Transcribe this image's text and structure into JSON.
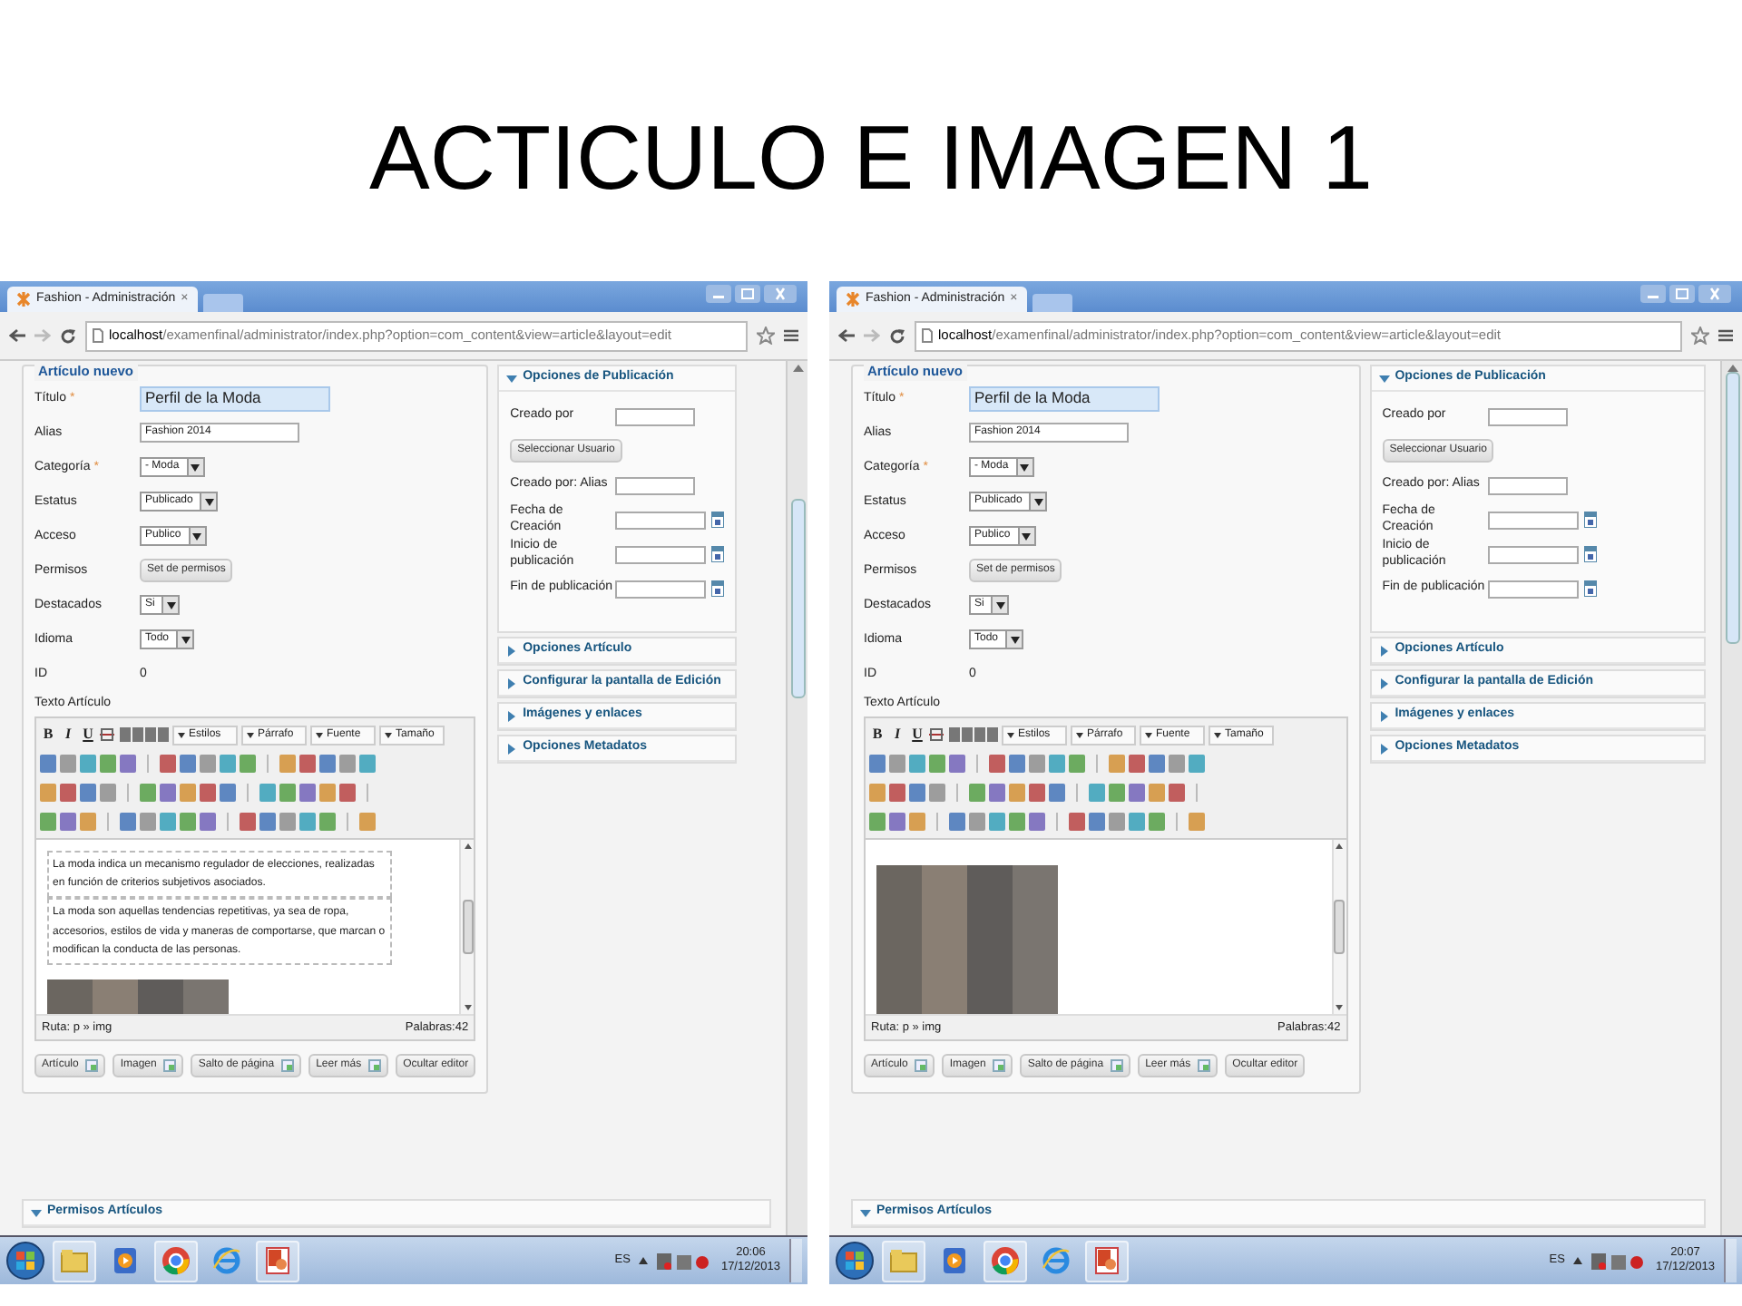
{
  "slide_title": "ACTICULO E IMAGEN 1",
  "screenshots": [
    {
      "browser": {
        "tab_title": "Fashion - Administración",
        "tab_close": "×",
        "url_host": "localhost",
        "url_path": "/examenfinal/administrator/index.php?option=com_content&view=article&layout=edit"
      },
      "article": {
        "legend": "Artículo nuevo",
        "fields": [
          {
            "kind": "text",
            "label": "Título",
            "required_mark": "*",
            "value": "Perfil de la Moda",
            "highlighted": true
          },
          {
            "kind": "text",
            "label": "Alias",
            "value": "Fashion 2014",
            "highlighted": false
          },
          {
            "kind": "select",
            "label": "Categoría",
            "required_mark": "*",
            "value": "- Moda"
          },
          {
            "kind": "select",
            "label": "Estatus",
            "value": "Publicado"
          },
          {
            "kind": "select",
            "label": "Acceso",
            "value": "Publico"
          },
          {
            "kind": "button",
            "label": "Permisos",
            "value": "Set de permisos"
          },
          {
            "kind": "select",
            "label": "Destacados",
            "value": "Si"
          },
          {
            "kind": "select",
            "label": "Idioma",
            "value": "Todo"
          },
          {
            "kind": "static",
            "label": "ID",
            "value": "0"
          }
        ],
        "editor_label": "Texto Artículo"
      },
      "editor": {
        "format_buttons": [
          "B",
          "I",
          "U"
        ],
        "dropdowns": [
          "Estilos",
          "Párrafo",
          "Fuente",
          "Tamaño"
        ],
        "content": [
          {
            "kind": "paragraph",
            "text": "La moda indica un mecanismo regulador de elecciones, realizadas en función de criterios subjetivos asociados."
          },
          {
            "kind": "paragraph",
            "text": "La moda son aquellas tendencias repetitivas, ya sea de ropa, accesorios, estilos de vida y maneras de comportarse, que marcan o modifican la conducta de las personas."
          },
          {
            "kind": "image"
          }
        ],
        "path": "Ruta: p » img",
        "word_count": "Palabras:42"
      },
      "editor_buttons": [
        {
          "label": "Artículo",
          "has_icon": true
        },
        {
          "label": "Imagen",
          "has_icon": true
        },
        {
          "label": "Salto de página",
          "has_icon": true
        },
        {
          "label": "Leer más",
          "has_icon": true
        },
        {
          "label": "Ocultar editor",
          "has_icon": false
        }
      ],
      "sidebar": {
        "sections": [
          {
            "title": "Opciones de Publicación",
            "expanded": true,
            "fields": [
              {
                "kind": "input",
                "label": "Creado por"
              },
              {
                "kind": "button",
                "label": "Seleccionar Usuario"
              },
              {
                "kind": "input",
                "label": "Creado por: Alias"
              },
              {
                "kind": "date",
                "label": "Fecha de Creación"
              },
              {
                "kind": "date",
                "label": "Inicio de publicación"
              },
              {
                "kind": "date",
                "label": "Fin de publicación"
              }
            ]
          },
          {
            "title": "Opciones Artículo",
            "expanded": false
          },
          {
            "title": "Configurar la pantalla de Edición",
            "expanded": false
          },
          {
            "title": "Imágenes y enlaces",
            "expanded": false
          },
          {
            "title": "Opciones Metadatos",
            "expanded": false
          }
        ]
      },
      "permissions_section": {
        "title": "Permisos Artículos",
        "expanded": true
      },
      "taskbar": {
        "language": "ES",
        "time": "20:06",
        "date": "17/12/2013"
      }
    },
    {
      "browser": {
        "tab_title": "Fashion - Administración",
        "tab_close": "×",
        "url_host": "localhost",
        "url_path": "/examenfinal/administrator/index.php?option=com_content&view=article&layout=edit"
      },
      "article": {
        "legend": "Artículo nuevo",
        "fields": [
          {
            "kind": "text",
            "label": "Título",
            "required_mark": "*",
            "value": "Perfil de la Moda",
            "highlighted": true
          },
          {
            "kind": "text",
            "label": "Alias",
            "value": "Fashion 2014",
            "highlighted": false
          },
          {
            "kind": "select",
            "label": "Categoría",
            "required_mark": "*",
            "value": "- Moda"
          },
          {
            "kind": "select",
            "label": "Estatus",
            "value": "Publicado"
          },
          {
            "kind": "select",
            "label": "Acceso",
            "value": "Publico"
          },
          {
            "kind": "button",
            "label": "Permisos",
            "value": "Set de permisos"
          },
          {
            "kind": "select",
            "label": "Destacados",
            "value": "Si"
          },
          {
            "kind": "select",
            "label": "Idioma",
            "value": "Todo"
          },
          {
            "kind": "static",
            "label": "ID",
            "value": "0"
          }
        ],
        "editor_label": "Texto Artículo"
      },
      "editor": {
        "format_buttons": [
          "B",
          "I",
          "U"
        ],
        "dropdowns": [
          "Estilos",
          "Párrafo",
          "Fuente",
          "Tamaño"
        ],
        "content": [
          {
            "kind": "image"
          }
        ],
        "path": "Ruta: p » img",
        "word_count": "Palabras:42"
      },
      "editor_buttons": [
        {
          "label": "Artículo",
          "has_icon": true
        },
        {
          "label": "Imagen",
          "has_icon": true
        },
        {
          "label": "Salto de página",
          "has_icon": true
        },
        {
          "label": "Leer más",
          "has_icon": true
        },
        {
          "label": "Ocultar editor",
          "has_icon": false
        }
      ],
      "sidebar": {
        "sections": [
          {
            "title": "Opciones de Publicación",
            "expanded": true,
            "fields": [
              {
                "kind": "input",
                "label": "Creado por"
              },
              {
                "kind": "button",
                "label": "Seleccionar Usuario"
              },
              {
                "kind": "input",
                "label": "Creado por: Alias"
              },
              {
                "kind": "date",
                "label": "Fecha de Creación"
              },
              {
                "kind": "date",
                "label": "Inicio de publicación"
              },
              {
                "kind": "date",
                "label": "Fin de publicación"
              }
            ]
          },
          {
            "title": "Opciones Artículo",
            "expanded": false
          },
          {
            "title": "Configurar la pantalla de Edición",
            "expanded": false
          },
          {
            "title": "Imágenes y enlaces",
            "expanded": false
          },
          {
            "title": "Opciones Metadatos",
            "expanded": false
          }
        ]
      },
      "permissions_section": {
        "title": "Permisos Artículos",
        "expanded": true
      },
      "taskbar": {
        "language": "ES",
        "time": "20:07",
        "date": "17/12/2013"
      }
    }
  ]
}
